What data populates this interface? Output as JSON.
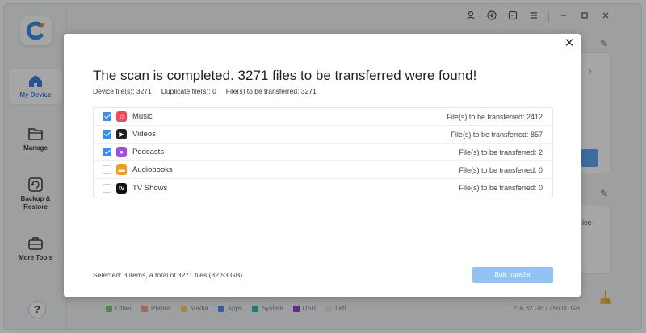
{
  "sidebar": {
    "items": [
      {
        "label": "My Device",
        "icon": "home-icon"
      },
      {
        "label": "Manage",
        "icon": "folder-icon"
      },
      {
        "label": "Backup &\nRestore",
        "icon": "backup-icon"
      },
      {
        "label": "More Tools",
        "icon": "toolbox-icon"
      }
    ],
    "help_label": "?"
  },
  "legend": [
    {
      "label": "Other",
      "color": "#7ccf7a"
    },
    {
      "label": "Photos",
      "color": "#f4a58a"
    },
    {
      "label": "Media",
      "color": "#f5cf7a"
    },
    {
      "label": "Apps",
      "color": "#5a8ff0"
    },
    {
      "label": "System",
      "color": "#33b8b8"
    },
    {
      "label": "USB",
      "color": "#9a3fc7"
    },
    {
      "label": "Left",
      "color": "#e4e6ea"
    }
  ],
  "storage": "216.32 GB / 256.00 GB",
  "background": {
    "partial_text": "ice"
  },
  "dialog": {
    "title": "The scan is completed. 3271 files to be transferred were found!",
    "stats": {
      "device": "Device file(s): 3271",
      "duplicate": "Duplicate file(s): 0",
      "to_transfer": "File(s) to be transferred: 3271"
    },
    "rows": [
      {
        "name": "Music",
        "count": "File(s) to be transferred: 2412",
        "checked": true,
        "icon": "music-icon",
        "color": "#f04a5c"
      },
      {
        "name": "Videos",
        "count": "File(s) to be transferred: 857",
        "checked": true,
        "icon": "video-icon",
        "color": "#222222"
      },
      {
        "name": "Podcasts",
        "count": "File(s) to be transferred: 2",
        "checked": true,
        "icon": "podcast-icon",
        "color": "#a04de0"
      },
      {
        "name": "Audiobooks",
        "count": "File(s) to be transferred: 0",
        "checked": false,
        "icon": "audiobook-icon",
        "color": "#f49a1e"
      },
      {
        "name": "TV Shows",
        "count": "File(s) to be transferred: 0",
        "checked": false,
        "icon": "tv-icon",
        "color": "#111111"
      }
    ],
    "selected": "Selected: 3 items, a total of 3271 files (32.53 GB)",
    "bulk_button": "Bulk transfer",
    "close": "✕"
  },
  "colors": {
    "accent": "#3b8ee8",
    "button_disabled": "#92c3f4"
  }
}
